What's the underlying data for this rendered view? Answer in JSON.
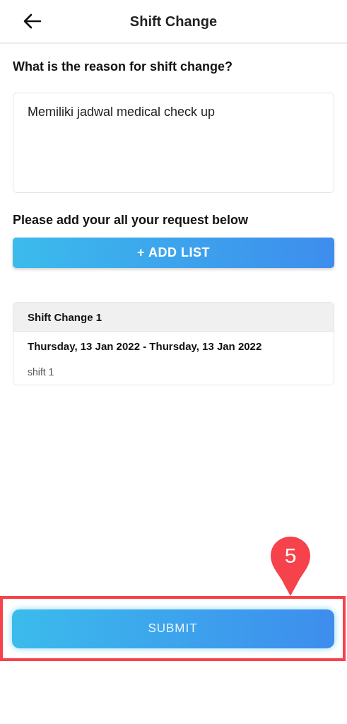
{
  "header": {
    "title": "Shift Change"
  },
  "reason": {
    "question": "What is the reason for shift change?",
    "value": "Memiliki jadwal medical check up"
  },
  "requests": {
    "label": "Please add your all your request below",
    "add_button": "+ ADD LIST",
    "items": [
      {
        "title": "Shift Change 1",
        "dates": "Thursday, 13 Jan 2022 - Thursday, 13 Jan 2022",
        "shift": "shift 1"
      }
    ]
  },
  "submit": {
    "label": "SUBMIT",
    "highlighted": true,
    "step": "5"
  }
}
